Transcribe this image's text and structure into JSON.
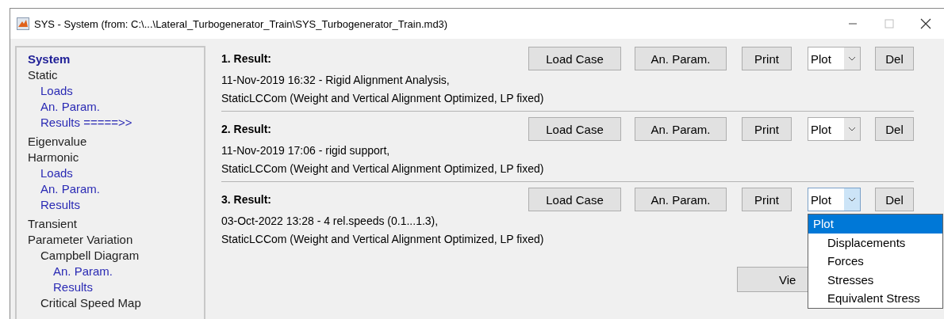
{
  "window": {
    "title": "SYS - System (from: C:\\...\\Lateral_Turbogenerator_Train\\SYS_Turbogenerator_Train.md3)",
    "maximize_disabled": true
  },
  "sidebar": {
    "items": [
      {
        "label": "System",
        "kind": "title"
      },
      {
        "label": "Static",
        "kind": "group",
        "children": [
          {
            "label": "Loads",
            "kind": "link"
          },
          {
            "label": "An. Param.",
            "kind": "link"
          },
          {
            "label": "Results =====>>",
            "kind": "link"
          }
        ]
      },
      {
        "label": "Eigenvalue",
        "kind": "group"
      },
      {
        "label": "Harmonic",
        "kind": "group",
        "children": [
          {
            "label": "Loads",
            "kind": "link"
          },
          {
            "label": "An. Param.",
            "kind": "link"
          },
          {
            "label": "Results",
            "kind": "link"
          }
        ]
      },
      {
        "label": "Transient",
        "kind": "group"
      },
      {
        "label": "Parameter Variation",
        "kind": "group",
        "children": [
          {
            "label": "Campbell Diagram",
            "kind": "group",
            "children": [
              {
                "label": "An. Param.",
                "kind": "link"
              },
              {
                "label": "Results",
                "kind": "link"
              }
            ]
          },
          {
            "label": "Critical Speed Map",
            "kind": "group"
          }
        ]
      }
    ]
  },
  "results": [
    {
      "heading": "1. Result:",
      "lines": [
        "11-Nov-2019 16:32 - Rigid Alignment Analysis,",
        "StaticLCCom (Weight and Vertical Alignment Optimized, LP fixed)"
      ],
      "buttons": [
        "Load Case",
        "An. Param.",
        "Print"
      ],
      "plot": {
        "value": "Plot",
        "expanded": false
      },
      "delete": "Del"
    },
    {
      "heading": "2. Result:",
      "lines": [
        "11-Nov-2019 17:06 - rigid support,",
        "StaticLCCom (Weight and Vertical Alignment Optimized, LP fixed)"
      ],
      "buttons": [
        "Load Case",
        "An. Param.",
        "Print"
      ],
      "plot": {
        "value": "Plot",
        "expanded": false
      },
      "delete": "Del"
    },
    {
      "heading": "3. Result:",
      "lines": [
        "03-Oct-2022 13:28 - 4 rel.speeds (0.1...1.3),",
        "StaticLCCom (Weight and Vertical Alignment Optimized, LP fixed)"
      ],
      "buttons": [
        "Load Case",
        "An. Param.",
        "Print"
      ],
      "plot": {
        "value": "Plot",
        "expanded": true,
        "options": [
          {
            "label": "Plot",
            "selected": true
          },
          {
            "label": "Displacements",
            "selected": false
          },
          {
            "label": "Forces",
            "selected": false
          },
          {
            "label": "Stresses",
            "selected": false
          },
          {
            "label": "Equivalent Stress",
            "selected": false
          }
        ]
      },
      "delete": "Del"
    }
  ],
  "footer_button": "Vie"
}
